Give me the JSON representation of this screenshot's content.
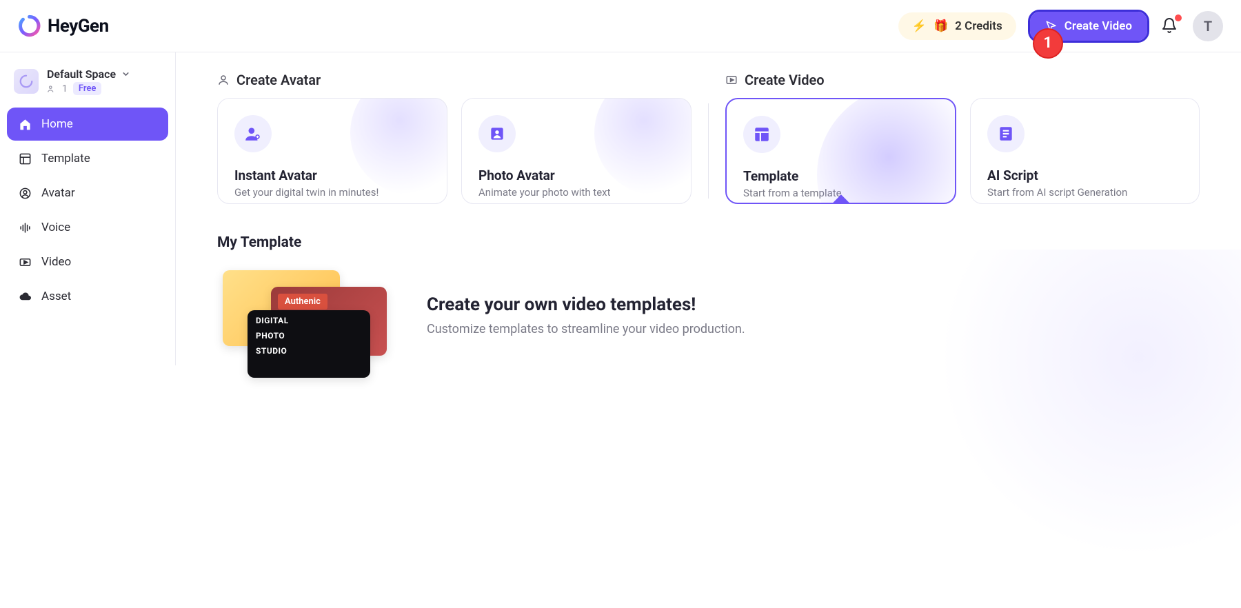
{
  "brand": "HeyGen",
  "header": {
    "credits_label": "2 Credits",
    "create_video_label": "Create Video",
    "callout_number": "1",
    "avatar_initial": "T"
  },
  "sidebar": {
    "space_name": "Default Space",
    "member_count": "1",
    "plan_label": "Free",
    "items": [
      {
        "key": "home",
        "label": "Home"
      },
      {
        "key": "template",
        "label": "Template"
      },
      {
        "key": "avatar",
        "label": "Avatar"
      },
      {
        "key": "voice",
        "label": "Voice"
      },
      {
        "key": "video",
        "label": "Video"
      },
      {
        "key": "asset",
        "label": "Asset"
      }
    ]
  },
  "sections": {
    "create_avatar_title": "Create Avatar",
    "create_video_title": "Create Video"
  },
  "cards": {
    "instant_avatar": {
      "title": "Instant Avatar",
      "subtitle": "Get your digital twin in minutes!"
    },
    "photo_avatar": {
      "title": "Photo Avatar",
      "subtitle": "Animate your photo with text"
    },
    "template": {
      "title": "Template",
      "subtitle": "Start from a template"
    },
    "ai_script": {
      "title": "AI Script",
      "subtitle": "Start from AI script Generation"
    }
  },
  "my_template": {
    "heading": "My Template",
    "promo_title": "Create your own video templates!",
    "promo_sub": "Customize templates to streamline your video production.",
    "thumb_b_label": "Authenic",
    "thumb_c_line1": "DIGITAL",
    "thumb_c_line2": "PHOTO",
    "thumb_c_line3": "STUDIO"
  },
  "colors": {
    "primary": "#6f55f7"
  }
}
